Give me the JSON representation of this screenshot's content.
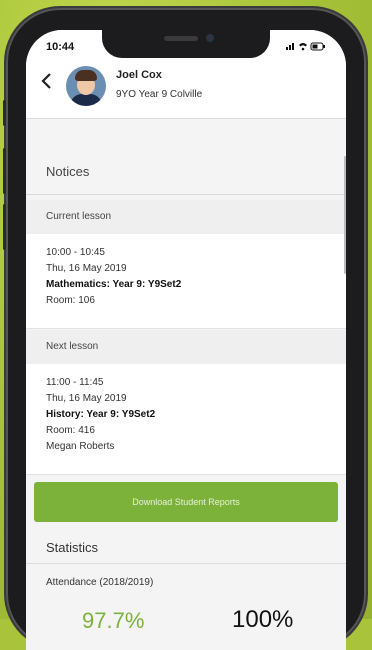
{
  "status": {
    "time": "10:44",
    "icons": "signal wifi battery"
  },
  "header": {
    "back_icon": "chevron-left-icon",
    "name": "Joel Cox",
    "meta": "9YO  Year 9  Colville"
  },
  "notices": {
    "title": "Notices"
  },
  "current_lesson": {
    "label": "Current lesson",
    "time": "10:00 - 10:45",
    "date": "Thu, 16 May 2019",
    "subject": "Mathematics: Year 9: Y9Set2",
    "room": "Room: 106"
  },
  "next_lesson": {
    "label": "Next lesson",
    "time": "11:00 - 11:45",
    "date": "Thu, 16 May 2019",
    "subject": "History: Year 9: Y9Set2",
    "room": "Room: 416",
    "teacher": "Megan Roberts"
  },
  "actions": {
    "download_label": "Download Student Reports"
  },
  "statistics": {
    "title": "Statistics",
    "attendance_label": "Attendance (2018/2019)",
    "value_left": "97.7%",
    "value_right": "100%"
  },
  "colors": {
    "accent_green": "#7cb23a",
    "background_green": "#a9c43a"
  }
}
